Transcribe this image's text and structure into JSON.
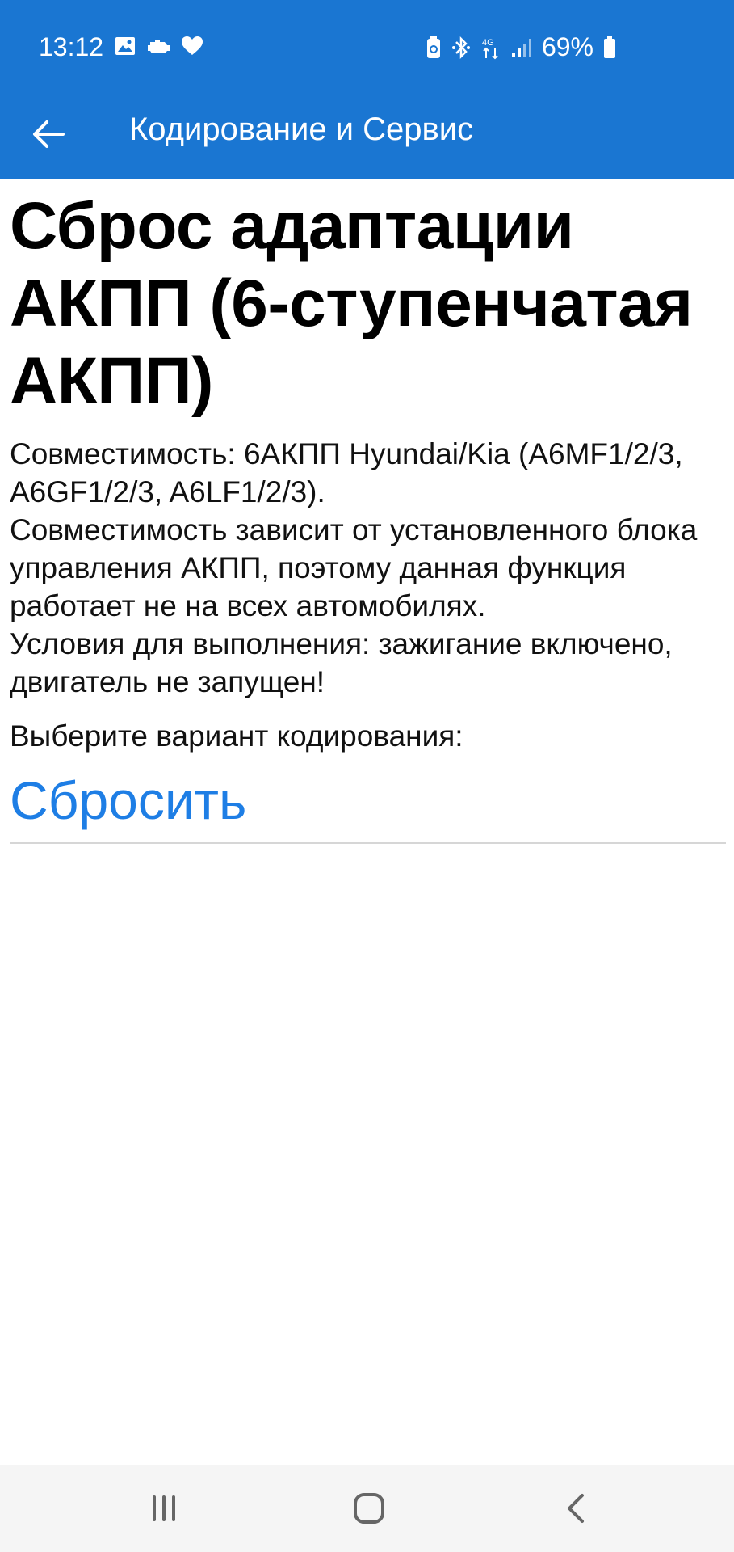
{
  "status_bar": {
    "time": "13:12",
    "battery_percent": "69%",
    "left_icons": [
      "image-icon",
      "check-engine-icon",
      "heart-icon"
    ],
    "right_icons": [
      "battery-saver-icon",
      "bluetooth-icon",
      "4g-data-icon",
      "signal-icon",
      "battery-icon"
    ]
  },
  "app_bar": {
    "title": "Кодирование и Сервис",
    "background": "#1a76d2"
  },
  "main": {
    "heading": "Сброс адаптации АКПП (6-ступенчатая АКПП)",
    "description": "Совместимость: 6АКПП Hyundai/Kia (A6MF1/2/3, A6GF1/2/3, A6LF1/2/3).\nСовместимость зависит от установленного блока управления АКПП, поэтому данная функция работает не на всех автомобилях.\nУсловия для выполнения: зажигание включено, двигатель не запущен!",
    "prompt": "Выберите вариант кодирования:",
    "options": [
      {
        "label": "Сбросить"
      }
    ],
    "accent": "#1e7ee5"
  },
  "nav_bar": {
    "buttons": [
      "recent-apps-icon",
      "home-icon",
      "back-icon"
    ]
  }
}
